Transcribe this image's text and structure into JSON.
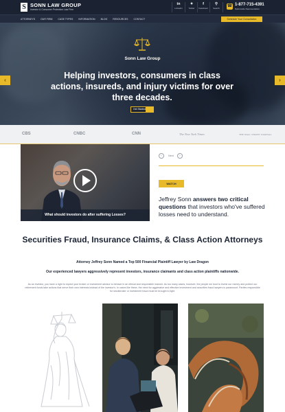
{
  "header": {
    "logo_letter": "S",
    "firm_name": "SONN LAW GROUP",
    "tagline": "Investor & Consumer Protection Law Firm",
    "social": [
      {
        "icon": "linkedin-icon",
        "glyph": "in",
        "label": "LinkedIn"
      },
      {
        "icon": "twitter-icon",
        "glyph": "🐦",
        "label": "Twitter"
      },
      {
        "icon": "facebook-icon",
        "glyph": "f",
        "label": "Facebook"
      },
      {
        "icon": "search-icon",
        "glyph": "⚲",
        "label": "Search"
      }
    ],
    "phone": "1-877-715-4391",
    "phone_sub": "Nationwide Representation"
  },
  "nav": {
    "items": [
      "ATTORNEYS",
      "OUR FIRM",
      "CASE TYPES",
      "INFORMATION",
      "BLOG",
      "RESOURCES",
      "CONTACT"
    ],
    "review_button": "Schedule Your Consultation"
  },
  "hero": {
    "firm": "Sonn Law Group",
    "headline": "Helping investors, consumers in class actions, insureds, and injury victims for over three decades.",
    "button": "Get Started",
    "prev": "‹",
    "next": "›"
  },
  "media": [
    "CBS",
    "CNBC",
    "CNN",
    "The New York Times",
    "THE WALL STREET JOURNAL"
  ],
  "video": {
    "caption": "What should investors do after suffering Losses?",
    "nav_label": "Next",
    "watch": "WATCH",
    "text_pre": "Jeffrey Sonn ",
    "text_bold": "answers two critical questions",
    "text_post": " that investors who've suffered losses need to understand."
  },
  "section": {
    "title": "Securities Fraud, Insurance Claims, & Class Action Attorneys",
    "sub1": "Attorney Jeffrey Sonn Named a Top 500 Financial Plaintiff Lawyer by Law Dragon",
    "sub2": "Our experienced lawyers aggressively represent investors, insurance claimants and class action plaintiffs nationwide.",
    "paragraph": "As an investor, you have a right to expect your broker or investment advisor to behave in an ethical and responsible manner. As too many cases, however, the people we trust to invest our money and protect our retirement funds take actions that serve their own interests instead of the investor's. In cases like these, the need for aggressive and effective investment and securities fraud lawyers is paramount. Parties responsible for stockbroker or investment fraud must be brought to light."
  },
  "colors": {
    "navy": "#1b2333",
    "gold": "#e8b928"
  }
}
